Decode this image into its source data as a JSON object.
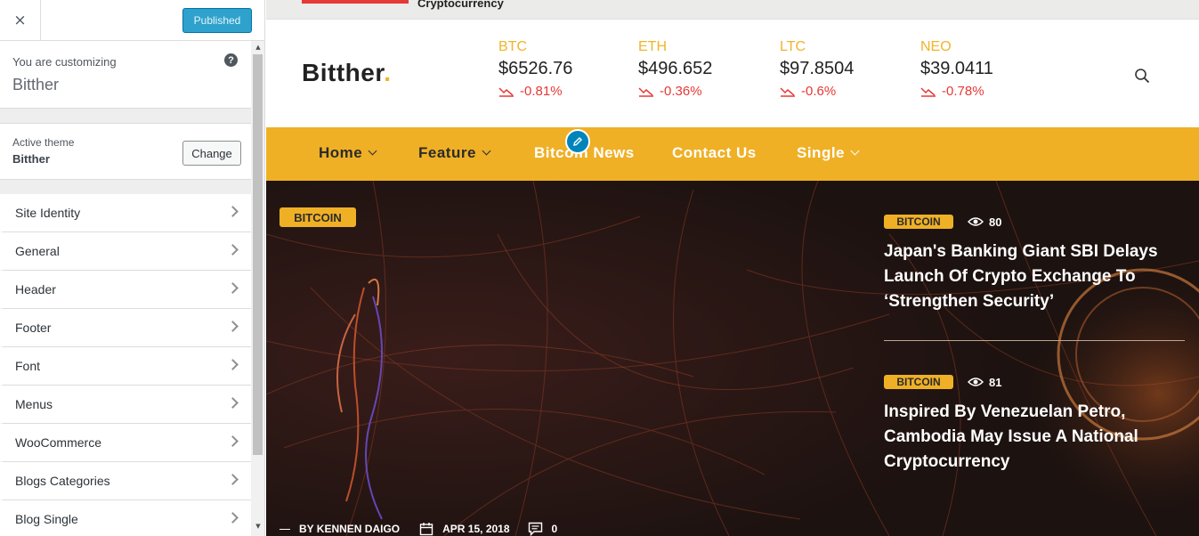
{
  "sidebar": {
    "close_glyph": "×",
    "publish_label": "Published",
    "customizing_label": "You are customizing",
    "site_title": "Bitther",
    "help_glyph": "?",
    "active_theme_label": "Active theme",
    "active_theme_name": "Bitther",
    "change_label": "Change",
    "panels": [
      {
        "label": "Site Identity"
      },
      {
        "label": "General"
      },
      {
        "label": "Header"
      },
      {
        "label": "Footer"
      },
      {
        "label": "Font"
      },
      {
        "label": "Menus"
      },
      {
        "label": "WooCommerce"
      },
      {
        "label": "Blogs Categories"
      },
      {
        "label": "Blog Single"
      }
    ]
  },
  "preview": {
    "top_text": "Cryptocurrency",
    "logo_text": "Bitther",
    "logo_dot": ".",
    "tickers": [
      {
        "symbol": "BTC",
        "price": "$6526.76",
        "change": "-0.81%"
      },
      {
        "symbol": "ETH",
        "price": "$496.652",
        "change": "-0.36%"
      },
      {
        "symbol": "LTC",
        "price": "$97.8504",
        "change": "-0.6%"
      },
      {
        "symbol": "NEO",
        "price": "$39.0411",
        "change": "-0.78%"
      }
    ],
    "nav": [
      {
        "label": "Home"
      },
      {
        "label": "Feature"
      },
      {
        "label": "Bitcoin News"
      },
      {
        "label": "Contact Us"
      },
      {
        "label": "Single"
      }
    ],
    "hero": {
      "badge": "BITCOIN",
      "author": "BY KENNEN DAIGO",
      "date": "APR 15, 2018",
      "comments": "0"
    },
    "side_posts": [
      {
        "badge": "BITCOIN",
        "views": "80",
        "title": "Japan's Banking Giant SBI Delays Launch Of Crypto Exchange To ‘Strengthen Security’"
      },
      {
        "badge": "BITCOIN",
        "views": "81",
        "title": "Inspired By Venezuelan Petro, Cambodia May Issue A National Cryptocurrency"
      }
    ]
  },
  "colors": {
    "accent_yellow": "#efb026",
    "negative_red": "#e53935",
    "wp_blue": "#0085ba"
  }
}
